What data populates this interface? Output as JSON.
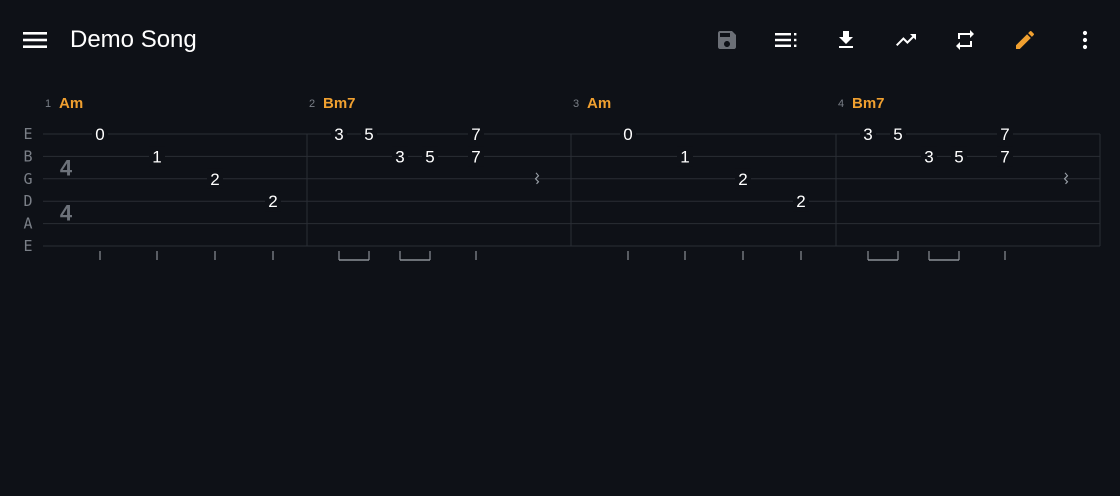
{
  "appbar": {
    "title": "Demo Song",
    "actions": [
      {
        "name": "save-icon",
        "color": "#6b6f76"
      },
      {
        "name": "playlist-icon",
        "color": "#ffffff"
      },
      {
        "name": "download-icon",
        "color": "#ffffff"
      },
      {
        "name": "trending-up-icon",
        "color": "#ffffff"
      },
      {
        "name": "repeat-icon",
        "color": "#ffffff"
      },
      {
        "name": "edit-pencil-icon",
        "color": "#f0a030"
      },
      {
        "name": "more-vert-icon",
        "color": "#ffffff"
      }
    ]
  },
  "colors": {
    "background": "#0e1117",
    "accent": "#f0a030",
    "line": "#2a2e35",
    "muted": "#7a7f87",
    "fret_text": "#ffffff"
  },
  "tab": {
    "strings": [
      "E",
      "B",
      "G",
      "D",
      "A",
      "E"
    ],
    "time_signature": {
      "top": "4",
      "bottom": "4"
    },
    "measures": [
      {
        "number": "1",
        "chord": "Am",
        "beats": [
          {
            "notes": [
              {
                "string": 0,
                "fret": "0"
              }
            ]
          },
          {
            "notes": [
              {
                "string": 1,
                "fret": "1"
              }
            ]
          },
          {
            "notes": [
              {
                "string": 2,
                "fret": "2"
              }
            ]
          },
          {
            "notes": [
              {
                "string": 3,
                "fret": "2"
              }
            ]
          }
        ]
      },
      {
        "number": "2",
        "chord": "Bm7",
        "beats": [
          {
            "notes": [
              {
                "string": 0,
                "fret": "3"
              }
            ],
            "beam": "start"
          },
          {
            "notes": [
              {
                "string": 0,
                "fret": "5"
              }
            ],
            "beam": "end"
          },
          {
            "notes": [
              {
                "string": 1,
                "fret": "3"
              }
            ],
            "beam": "start"
          },
          {
            "notes": [
              {
                "string": 1,
                "fret": "5"
              }
            ],
            "beam": "end"
          },
          {
            "notes": [
              {
                "string": 0,
                "fret": "7"
              },
              {
                "string": 1,
                "fret": "7"
              }
            ]
          },
          {
            "rest": true
          }
        ]
      },
      {
        "number": "3",
        "chord": "Am",
        "beats": [
          {
            "notes": [
              {
                "string": 0,
                "fret": "0"
              }
            ]
          },
          {
            "notes": [
              {
                "string": 1,
                "fret": "1"
              }
            ]
          },
          {
            "notes": [
              {
                "string": 2,
                "fret": "2"
              }
            ]
          },
          {
            "notes": [
              {
                "string": 3,
                "fret": "2"
              }
            ]
          }
        ]
      },
      {
        "number": "4",
        "chord": "Bm7",
        "beats": [
          {
            "notes": [
              {
                "string": 0,
                "fret": "3"
              }
            ],
            "beam": "start"
          },
          {
            "notes": [
              {
                "string": 0,
                "fret": "5"
              }
            ],
            "beam": "end"
          },
          {
            "notes": [
              {
                "string": 1,
                "fret": "3"
              }
            ],
            "beam": "start"
          },
          {
            "notes": [
              {
                "string": 1,
                "fret": "5"
              }
            ],
            "beam": "end"
          },
          {
            "notes": [
              {
                "string": 0,
                "fret": "7"
              },
              {
                "string": 1,
                "fret": "7"
              }
            ]
          },
          {
            "rest": true
          }
        ]
      }
    ]
  }
}
